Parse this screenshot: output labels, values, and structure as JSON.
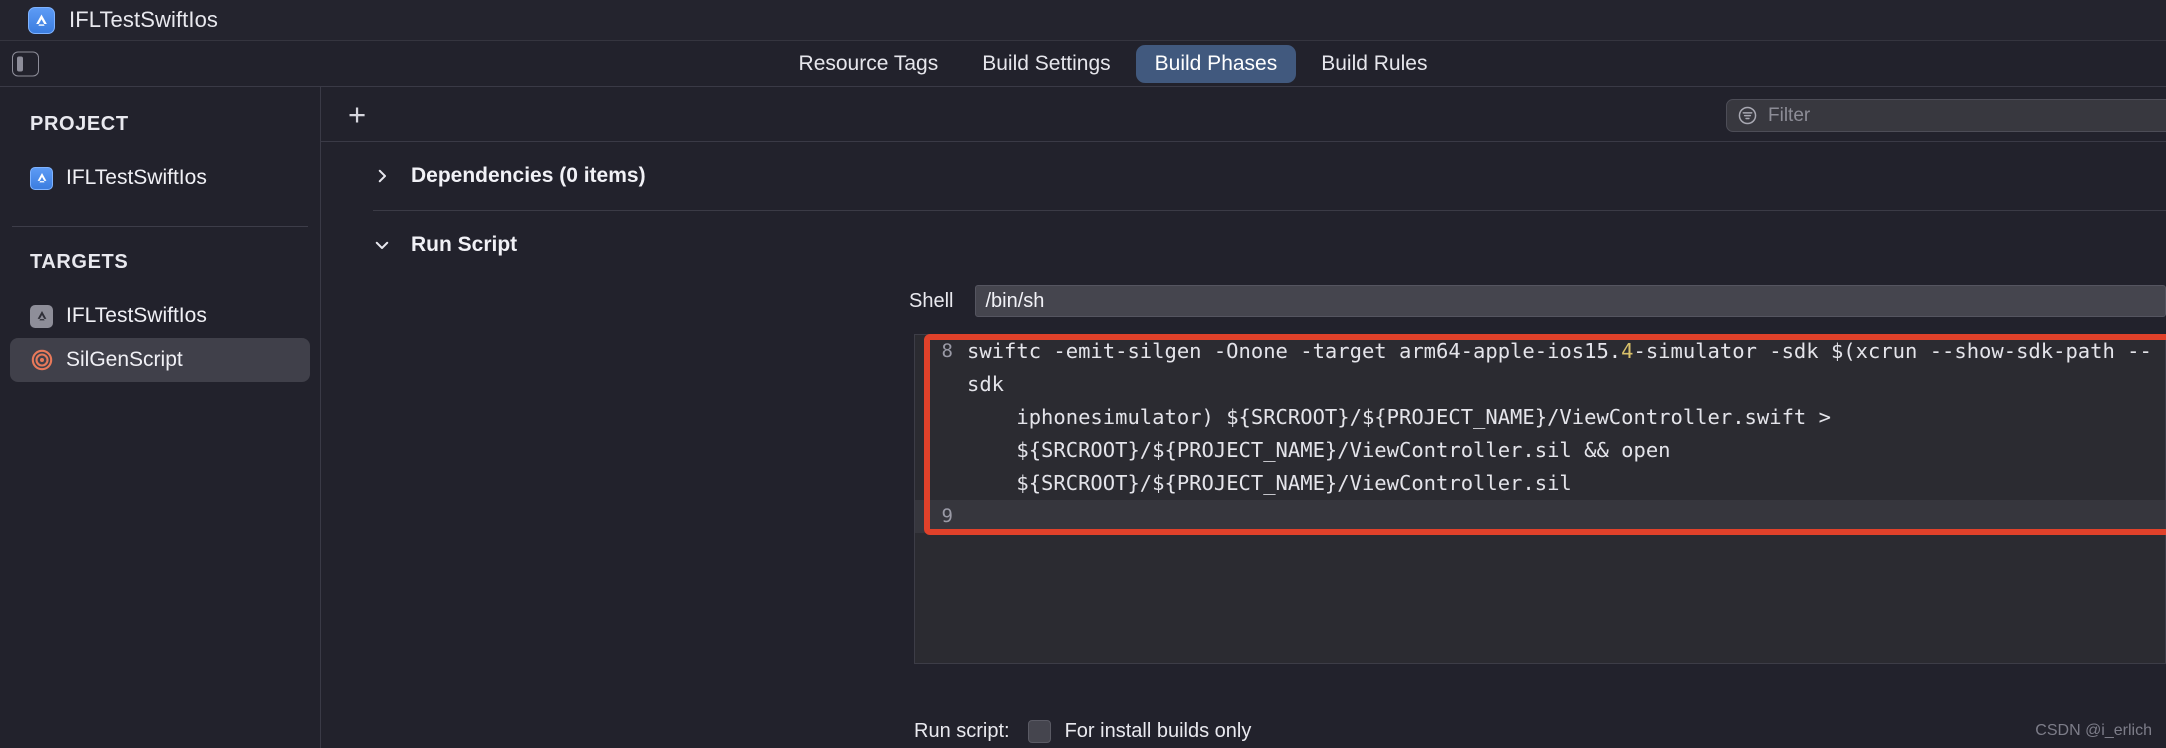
{
  "window": {
    "title": "IFLTestSwiftIos",
    "app_icon": "appstore-icon",
    "sidebar_toggle_icon": "sidebar-toggle-icon"
  },
  "tabs": [
    {
      "label": "Resource Tags",
      "active": false
    },
    {
      "label": "Build Settings",
      "active": false
    },
    {
      "label": "Build Phases",
      "active": true
    },
    {
      "label": "Build Rules",
      "active": false
    }
  ],
  "sidebar": {
    "project_section": {
      "label": "PROJECT",
      "items": [
        {
          "label": "IFLTestSwiftIos",
          "icon": "appstore-icon",
          "selected": false
        }
      ]
    },
    "targets_section": {
      "label": "TARGETS",
      "items": [
        {
          "label": "IFLTestSwiftIos",
          "icon": "appstore-icon",
          "selected": false
        },
        {
          "label": "SilGenScript",
          "icon": "target-rings-icon",
          "selected": true
        }
      ]
    }
  },
  "toolbar": {
    "add_label": "+",
    "add_icon": "plus-icon",
    "filter_icon": "filter-icon",
    "filter_placeholder": "Filter",
    "filter_value": ""
  },
  "phases": [
    {
      "title": "Dependencies (0 items)",
      "expanded": false,
      "chevron": "chevron-right-icon"
    },
    {
      "title": "Run Script",
      "expanded": true,
      "chevron": "chevron-down-icon"
    }
  ],
  "run_script": {
    "shell_label": "Shell",
    "shell_value": "/bin/sh",
    "code_lines": [
      {
        "number": "8",
        "segments": [
          {
            "text": "swiftc -emit-silgen -Onone -target arm64-apple-ios15."
          },
          {
            "text": "4",
            "token": "number"
          },
          {
            "text": "-simulator -sdk $(xcrun --show-sdk-path --sdk\n    iphonesimulator) ${SRCROOT}/${PROJECT_NAME}/ViewController.swift >\n    ${SRCROOT}/${PROJECT_NAME}/ViewController.sil && open\n    ${SRCROOT}/${PROJECT_NAME}/ViewController.sil"
          }
        ],
        "current": false
      },
      {
        "number": "9",
        "segments": [
          {
            "text": ""
          }
        ],
        "current": true
      }
    ],
    "highlight_color": "#e0412a",
    "footer_label": "Run script:",
    "footer_checkbox_label": "For install builds only",
    "footer_checkbox_checked": false
  },
  "watermark": "CSDN @i_erlich"
}
